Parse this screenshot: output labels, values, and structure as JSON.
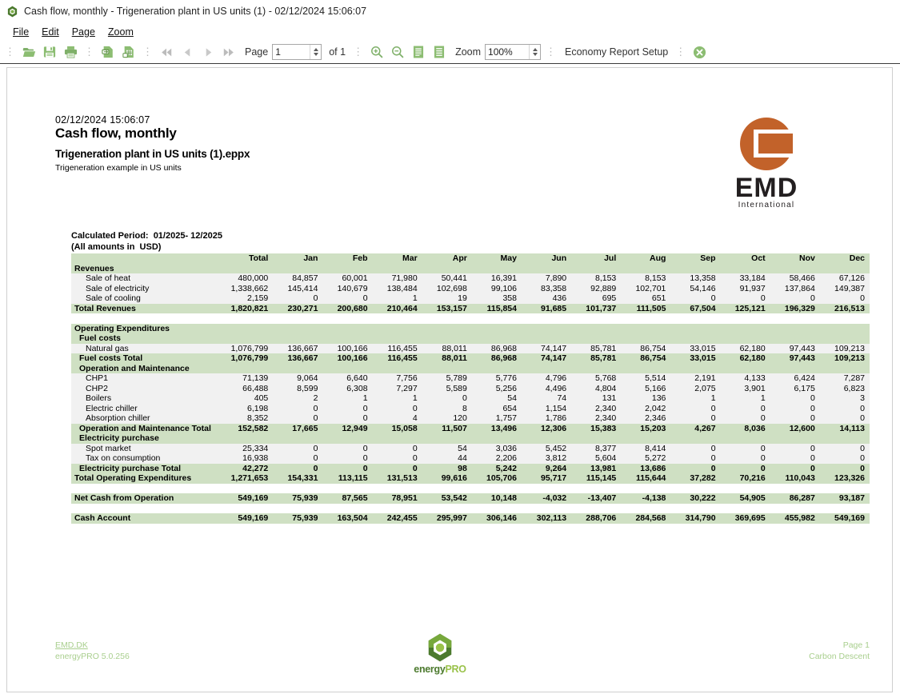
{
  "window": {
    "title": "Cash flow, monthly - Trigeneration plant in US units (1) - 02/12/2024 15:06:07",
    "app_icon": "energypro-hexagon-icon"
  },
  "menu": {
    "items": [
      "File",
      "Edit",
      "Page",
      "Zoom"
    ]
  },
  "toolbar": {
    "open_icon": "open-folder-icon",
    "save_icon": "save-disk-icon",
    "print_icon": "print-icon",
    "export_icon": "export-document-icon",
    "export_excel_icon": "export-spreadsheet-icon",
    "first_page_icon": "first-page-icon",
    "prev_page_icon": "previous-page-icon",
    "next_page_icon": "next-page-icon",
    "last_page_icon": "last-page-icon",
    "page_label": "Page",
    "page_value": "1",
    "of_label": "of 1",
    "zoom_in_icon": "zoom-in-icon",
    "zoom_out_icon": "zoom-out-icon",
    "fit_page_icon": "fit-page-icon",
    "fit_width_icon": "fit-width-icon",
    "zoom_label": "Zoom",
    "zoom_value": "100%",
    "setup_label": "Economy Report Setup",
    "close_icon": "close-circle-icon"
  },
  "document": {
    "date": "02/12/2024  15:06:07",
    "title": "Cash flow, monthly",
    "file_name": "Trigeneration plant in US units (1).eppx",
    "subtitle": "Trigeneration example in US units",
    "calculated_period": "Calculated Period:  01/2025- 12/2025\n(All amounts in  USD)",
    "logo": {
      "name": "EMD",
      "tagline": "International",
      "color": "#c2622a"
    },
    "footer": {
      "link": "EMD.DK",
      "version": "energyPRO 5.0.256",
      "page": "Page 1",
      "project": "Carbon Descent",
      "logo_word_a": "energy",
      "logo_word_b": "PRO"
    }
  },
  "table": {
    "columns": [
      "",
      "Total",
      "Jan",
      "Feb",
      "Mar",
      "Apr",
      "May",
      "Jun",
      "Jul",
      "Aug",
      "Sep",
      "Oct",
      "Nov",
      "Dec"
    ],
    "rows": [
      {
        "type": "section",
        "label": "Revenues",
        "values": [
          "",
          "",
          "",
          "",
          "",
          "",
          "",
          "",
          "",
          "",
          "",
          "",
          ""
        ]
      },
      {
        "type": "data",
        "label": "Sale of heat",
        "indent": 2,
        "values": [
          "480,000",
          "84,857",
          "60,001",
          "71,980",
          "50,441",
          "16,391",
          "7,890",
          "8,153",
          "8,153",
          "13,358",
          "33,184",
          "58,466",
          "67,126"
        ]
      },
      {
        "type": "data",
        "label": "Sale of electricity",
        "indent": 2,
        "values": [
          "1,338,662",
          "145,414",
          "140,679",
          "138,484",
          "102,698",
          "99,106",
          "83,358",
          "92,889",
          "102,701",
          "54,146",
          "91,937",
          "137,864",
          "149,387"
        ]
      },
      {
        "type": "data",
        "label": "Sale of cooling",
        "indent": 2,
        "values": [
          "2,159",
          "0",
          "0",
          "1",
          "19",
          "358",
          "436",
          "695",
          "651",
          "0",
          "0",
          "0",
          "0"
        ]
      },
      {
        "type": "total",
        "label": "Total Revenues",
        "indent": 0,
        "values": [
          "1,820,821",
          "230,271",
          "200,680",
          "210,464",
          "153,157",
          "115,854",
          "91,685",
          "101,737",
          "111,505",
          "67,504",
          "125,121",
          "196,329",
          "216,513"
        ]
      },
      {
        "type": "blank"
      },
      {
        "type": "section",
        "label": "Operating Expenditures",
        "values": [
          "",
          "",
          "",
          "",
          "",
          "",
          "",
          "",
          "",
          "",
          "",
          "",
          ""
        ]
      },
      {
        "type": "sub",
        "label": "Fuel costs",
        "indent": 1,
        "values": [
          "",
          "",
          "",
          "",
          "",
          "",
          "",
          "",
          "",
          "",
          "",
          "",
          ""
        ]
      },
      {
        "type": "data",
        "label": "Natural gas",
        "indent": 2,
        "values": [
          "1,076,799",
          "136,667",
          "100,166",
          "116,455",
          "88,011",
          "86,968",
          "74,147",
          "85,781",
          "86,754",
          "33,015",
          "62,180",
          "97,443",
          "109,213"
        ]
      },
      {
        "type": "total",
        "label": "Fuel costs Total",
        "indent": 1,
        "values": [
          "1,076,799",
          "136,667",
          "100,166",
          "116,455",
          "88,011",
          "86,968",
          "74,147",
          "85,781",
          "86,754",
          "33,015",
          "62,180",
          "97,443",
          "109,213"
        ]
      },
      {
        "type": "sub",
        "label": "Operation and Maintenance",
        "indent": 1,
        "values": [
          "",
          "",
          "",
          "",
          "",
          "",
          "",
          "",
          "",
          "",
          "",
          "",
          ""
        ]
      },
      {
        "type": "data",
        "label": "CHP1",
        "indent": 2,
        "values": [
          "71,139",
          "9,064",
          "6,640",
          "7,756",
          "5,789",
          "5,776",
          "4,796",
          "5,768",
          "5,514",
          "2,191",
          "4,133",
          "6,424",
          "7,287"
        ]
      },
      {
        "type": "data",
        "label": "CHP2",
        "indent": 2,
        "values": [
          "66,488",
          "8,599",
          "6,308",
          "7,297",
          "5,589",
          "5,256",
          "4,496",
          "4,804",
          "5,166",
          "2,075",
          "3,901",
          "6,175",
          "6,823"
        ]
      },
      {
        "type": "data",
        "label": "Boilers",
        "indent": 2,
        "values": [
          "405",
          "2",
          "1",
          "1",
          "0",
          "54",
          "74",
          "131",
          "136",
          "1",
          "1",
          "0",
          "3"
        ]
      },
      {
        "type": "data",
        "label": "Electric chiller",
        "indent": 2,
        "values": [
          "6,198",
          "0",
          "0",
          "0",
          "8",
          "654",
          "1,154",
          "2,340",
          "2,042",
          "0",
          "0",
          "0",
          "0"
        ]
      },
      {
        "type": "data",
        "label": "Absorption chiller",
        "indent": 2,
        "values": [
          "8,352",
          "0",
          "0",
          "4",
          "120",
          "1,757",
          "1,786",
          "2,340",
          "2,346",
          "0",
          "0",
          "0",
          "0"
        ]
      },
      {
        "type": "total",
        "label": "Operation and Maintenance Total",
        "indent": 1,
        "values": [
          "152,582",
          "17,665",
          "12,949",
          "15,058",
          "11,507",
          "13,496",
          "12,306",
          "15,383",
          "15,203",
          "4,267",
          "8,036",
          "12,600",
          "14,113"
        ]
      },
      {
        "type": "sub",
        "label": "Electricity purchase",
        "indent": 1,
        "values": [
          "",
          "",
          "",
          "",
          "",
          "",
          "",
          "",
          "",
          "",
          "",
          "",
          ""
        ]
      },
      {
        "type": "data",
        "label": "Spot market",
        "indent": 2,
        "values": [
          "25,334",
          "0",
          "0",
          "0",
          "54",
          "3,036",
          "5,452",
          "8,377",
          "8,414",
          "0",
          "0",
          "0",
          "0"
        ]
      },
      {
        "type": "data",
        "label": "Tax on consumption",
        "indent": 2,
        "values": [
          "16,938",
          "0",
          "0",
          "0",
          "44",
          "2,206",
          "3,812",
          "5,604",
          "5,272",
          "0",
          "0",
          "0",
          "0"
        ]
      },
      {
        "type": "total",
        "label": "Electricity purchase Total",
        "indent": 1,
        "values": [
          "42,272",
          "0",
          "0",
          "0",
          "98",
          "5,242",
          "9,264",
          "13,981",
          "13,686",
          "0",
          "0",
          "0",
          "0"
        ]
      },
      {
        "type": "total",
        "label": "Total Operating Expenditures",
        "indent": 0,
        "values": [
          "1,271,653",
          "154,331",
          "113,115",
          "131,513",
          "99,616",
          "105,706",
          "95,717",
          "115,145",
          "115,644",
          "37,282",
          "70,216",
          "110,043",
          "123,326"
        ]
      },
      {
        "type": "blank"
      },
      {
        "type": "total",
        "label": "Net Cash from Operation",
        "indent": 0,
        "values": [
          "549,169",
          "75,939",
          "87,565",
          "78,951",
          "53,542",
          "10,148",
          "-4,032",
          "-13,407",
          "-4,138",
          "30,222",
          "54,905",
          "86,287",
          "93,187"
        ]
      },
      {
        "type": "blank"
      },
      {
        "type": "total",
        "label": "Cash Account",
        "indent": 0,
        "values": [
          "549,169",
          "75,939",
          "163,504",
          "242,455",
          "295,997",
          "306,146",
          "302,113",
          "288,706",
          "284,568",
          "314,790",
          "369,695",
          "455,982",
          "549,169"
        ]
      }
    ]
  },
  "colors": {
    "header_green": "#cfe0c3",
    "data_gray": "#f1f1f1",
    "footer_green": "#a9cf8e",
    "toolbar_icon_green": "#7fb069"
  }
}
